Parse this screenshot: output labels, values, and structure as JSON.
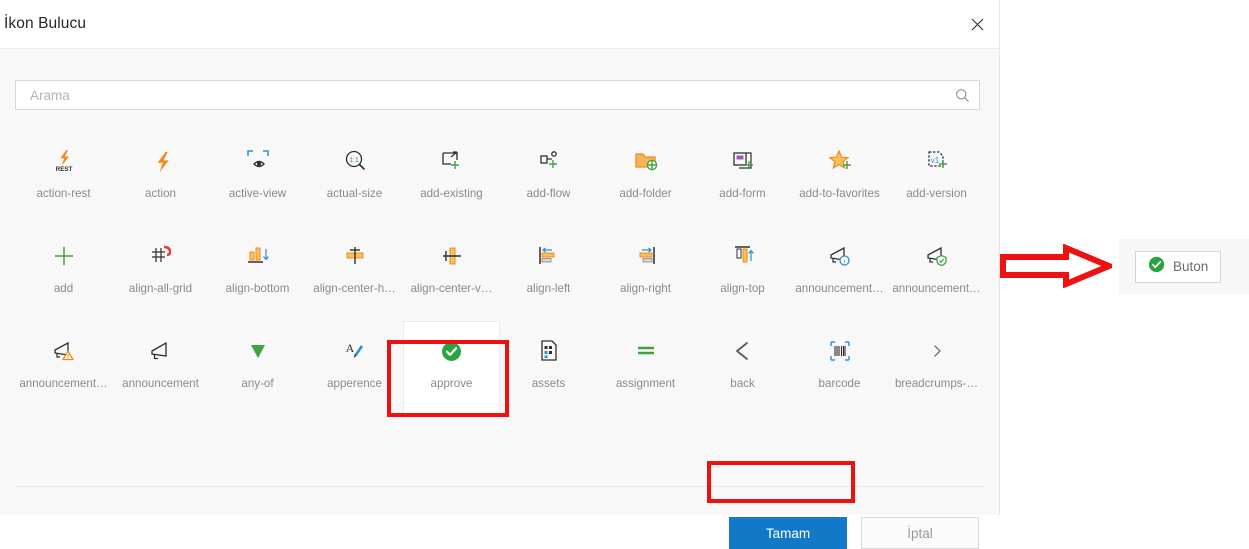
{
  "dialog": {
    "title": "İkon Bulucu",
    "close_icon": "close-icon",
    "search": {
      "placeholder": "Arama",
      "value": "",
      "icon": "search-icon"
    },
    "footer": {
      "ok_label": "Tamam",
      "cancel_label": "İptal"
    }
  },
  "icons": [
    {
      "label": "action-rest",
      "icon": "bolt-rest-icon"
    },
    {
      "label": "action",
      "icon": "bolt-icon"
    },
    {
      "label": "active-view",
      "icon": "active-view-icon"
    },
    {
      "label": "actual-size",
      "icon": "actual-size-icon"
    },
    {
      "label": "add-existing",
      "icon": "add-existing-icon"
    },
    {
      "label": "add-flow",
      "icon": "add-flow-icon"
    },
    {
      "label": "add-folder",
      "icon": "add-folder-icon"
    },
    {
      "label": "add-form",
      "icon": "add-form-icon"
    },
    {
      "label": "add-to-favorites",
      "icon": "add-to-favorites-icon"
    },
    {
      "label": "add-version",
      "icon": "add-version-icon"
    },
    {
      "label": "add",
      "icon": "plus-icon"
    },
    {
      "label": "align-all-grid",
      "icon": "align-all-grid-icon"
    },
    {
      "label": "align-bottom",
      "icon": "align-bottom-icon"
    },
    {
      "label": "align-center-h…",
      "icon": "align-center-horizontal-icon"
    },
    {
      "label": "align-center-v…",
      "icon": "align-center-vertical-icon"
    },
    {
      "label": "align-left",
      "icon": "align-left-icon"
    },
    {
      "label": "align-right",
      "icon": "align-right-icon"
    },
    {
      "label": "align-top",
      "icon": "align-top-icon"
    },
    {
      "label": "announcement…",
      "icon": "announcement-info-icon"
    },
    {
      "label": "announcement…",
      "icon": "announcement-approved-icon"
    },
    {
      "label": "announcement…",
      "icon": "announcement-warning-icon"
    },
    {
      "label": "announcement",
      "icon": "announcement-icon"
    },
    {
      "label": "any-of",
      "icon": "any-of-icon"
    },
    {
      "label": "apperence",
      "icon": "apperence-icon"
    },
    {
      "label": "approve",
      "icon": "approve-icon",
      "selected": true
    },
    {
      "label": "assets",
      "icon": "assets-icon"
    },
    {
      "label": "assignment",
      "icon": "assignment-icon"
    },
    {
      "label": "back",
      "icon": "back-arrow-icon"
    },
    {
      "label": "barcode",
      "icon": "barcode-icon"
    },
    {
      "label": "breadcrumps-…",
      "icon": "breadcrumps-chevron-icon"
    }
  ],
  "preview": {
    "button_label": "Buton",
    "button_icon": "approve-icon",
    "arrow_icon": "right-arrow-annotation"
  },
  "annotations": {
    "color": "#ee1111",
    "highlighted": [
      "approve",
      "Tamam"
    ]
  }
}
